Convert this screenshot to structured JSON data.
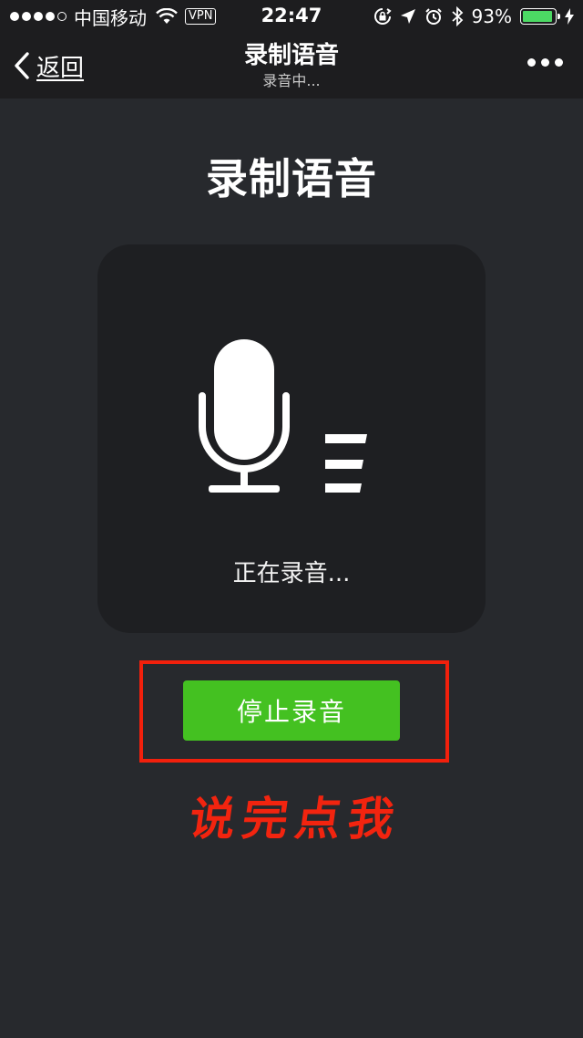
{
  "status_bar": {
    "carrier": "中国移动",
    "vpn": "VPN",
    "time": "22:47",
    "battery_percent": "93%",
    "battery_level": 0.93,
    "battery_color": "#4cd964"
  },
  "nav": {
    "back_label": "返回",
    "title": "录制语音",
    "subtitle": "录音中..."
  },
  "main": {
    "heading": "录制语音",
    "recording_status": "正在录音...",
    "stop_button_label": "停止录音",
    "annotation": "说完点我",
    "button_color": "#44c121",
    "highlight_color": "#f2200c"
  },
  "icons": [
    "signal-icon",
    "wifi-icon",
    "lock-rotation-icon",
    "location-arrow-icon",
    "alarm-icon",
    "bluetooth-icon",
    "battery-icon",
    "charging-bolt-icon",
    "back-chevron-icon",
    "more-icon",
    "microphone-icon",
    "volume-level-icon"
  ]
}
